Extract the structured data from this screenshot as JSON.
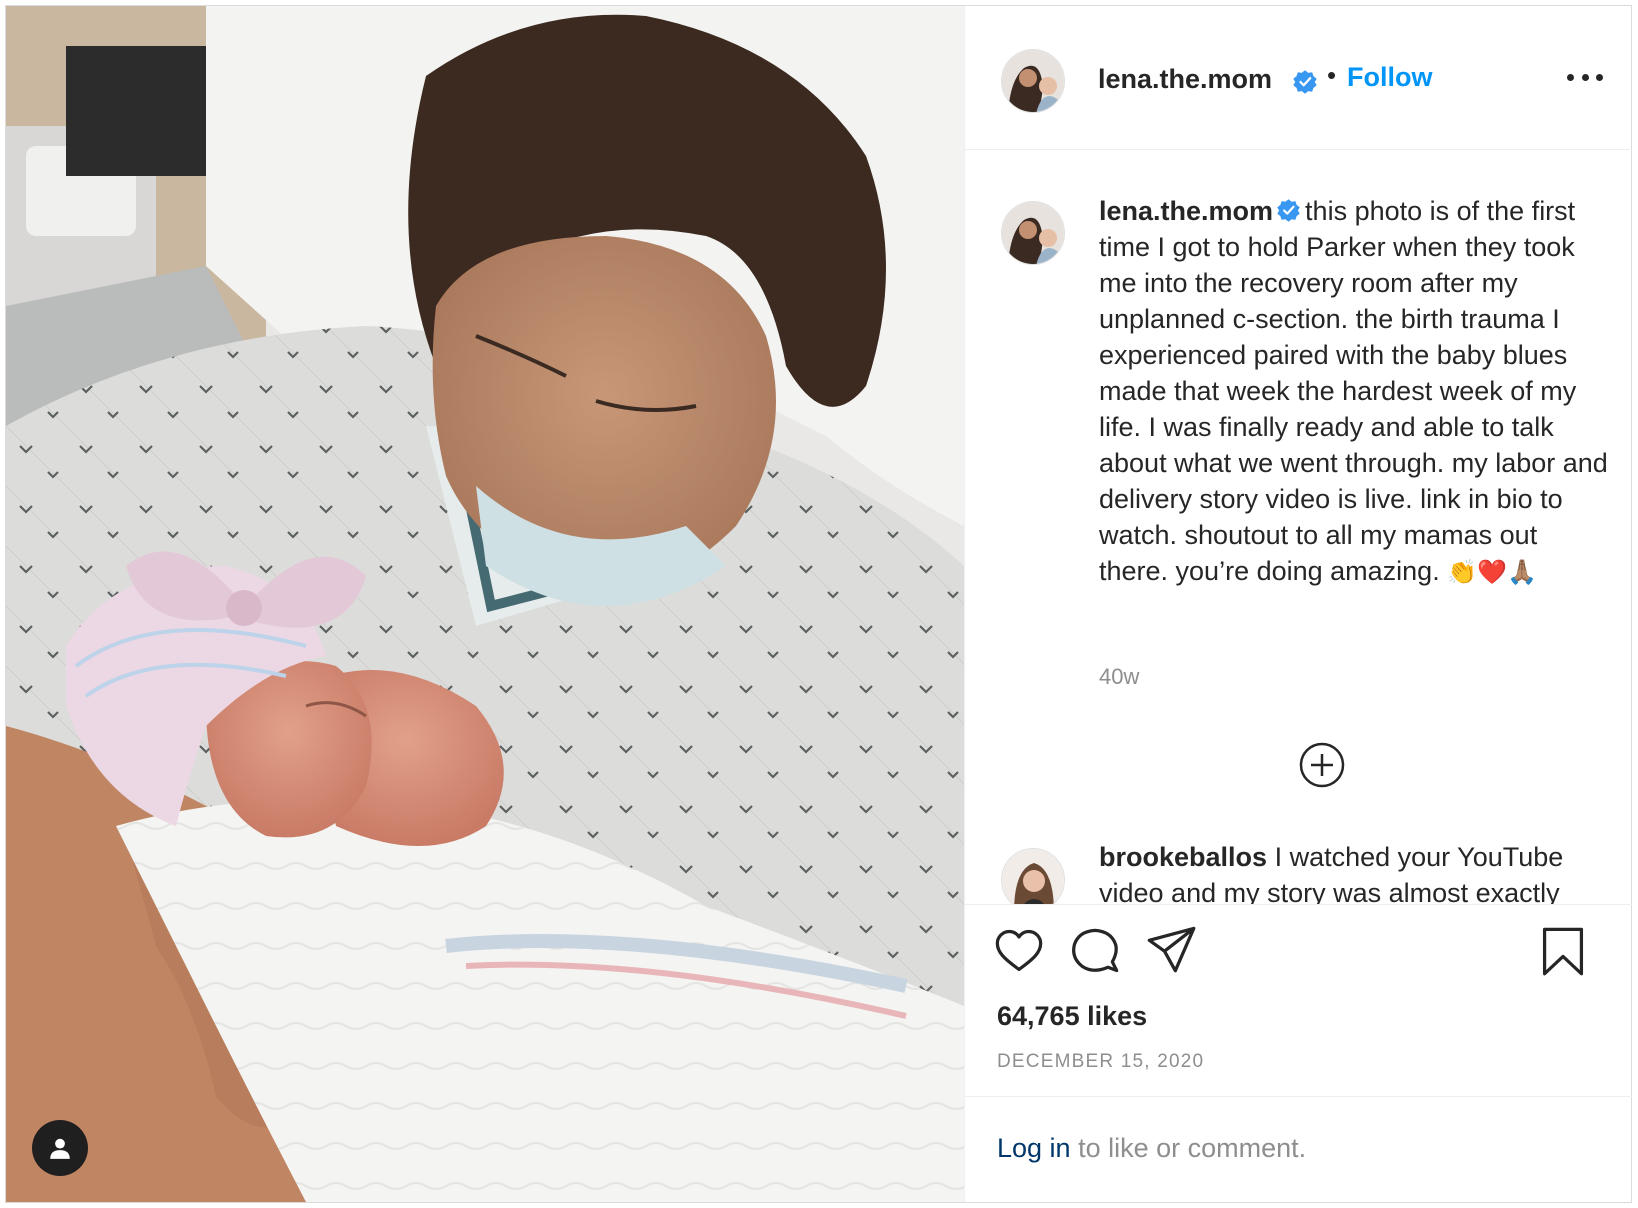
{
  "post": {
    "username": "lena.the.mom",
    "follow_label": "Follow",
    "separator": "•"
  },
  "caption": {
    "username": "lena.the.mom",
    "text": "this photo is of the first time I got to hold Parker when they took me into the recovery room after my unplanned c-section. the birth trauma I experienced paired with the baby blues made that week the hardest week of my life. I was finally ready and able to talk about what we went through. my labor and delivery story video is live. link in bio to watch. shoutout to all my mamas out there. you’re doing amazing.",
    "emoji": "👏❤️🙏🏽",
    "age": "40w"
  },
  "comment": {
    "username": "brookeballos",
    "text": "I watched your YouTube video and my story was almost exactly"
  },
  "stats": {
    "likes": "64,765 likes",
    "date": "DECEMBER 15, 2020"
  },
  "login": {
    "link": "Log in",
    "rest": " to like or comment."
  },
  "colors": {
    "link_blue": "#0095f6",
    "verified_blue": "#3897f0",
    "text": "#262626",
    "muted": "#8e8e8e",
    "login_link": "#00376b"
  },
  "icons": [
    "verified-badge-icon",
    "more-options-icon",
    "load-more-comments-icon",
    "heart-icon",
    "comment-icon",
    "share-icon",
    "bookmark-icon",
    "user-tags-icon"
  ]
}
